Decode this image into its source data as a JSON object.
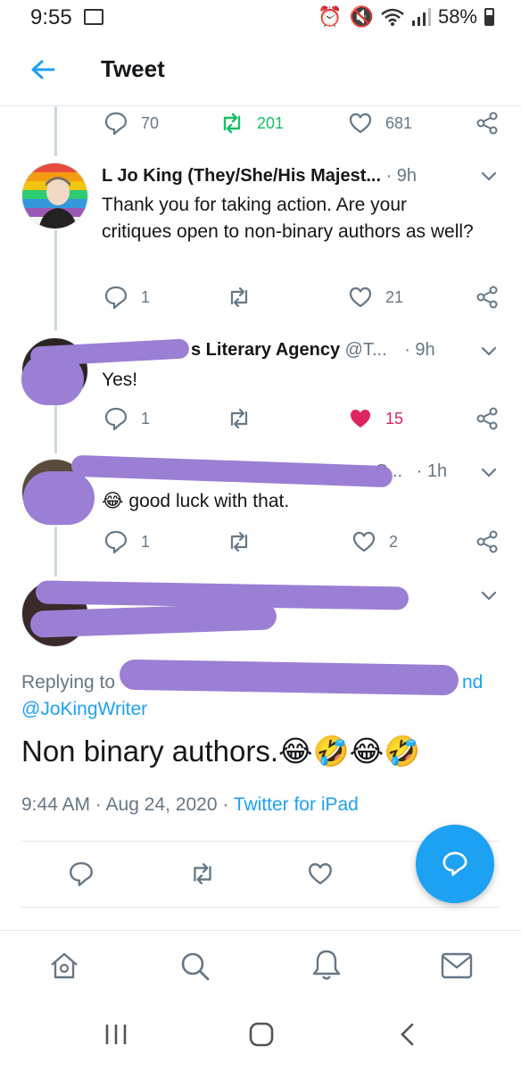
{
  "status_bar": {
    "time": "9:55",
    "battery": "58%"
  },
  "header": {
    "title": "Tweet"
  },
  "top_actions": {
    "reply_count": "70",
    "retweet_count": "201",
    "like_count": "681"
  },
  "replies": [
    {
      "name": "L Jo King (They/She/His Majest...",
      "time": "· 9h",
      "text": "Thank you for taking action. Are your critiques open to non-binary authors as well?",
      "reply_count": "1",
      "like_count": "21"
    },
    {
      "name": "s Literary Agency",
      "handle": "@T...",
      "time": "· 9h",
      "text": "Yes!",
      "reply_count": "1",
      "like_count": "15",
      "liked": true
    },
    {
      "name_fragment": "C...",
      "time": "· 1h",
      "emoji": "😂",
      "text": "good luck with that.",
      "reply_count": "1",
      "like_count": "2"
    }
  ],
  "main_tweet": {
    "replying_prefix": "Replying to",
    "replying_fragment": "nd",
    "replying_handle": "@JoKingWriter",
    "text": "Non binary authors.",
    "emojis": "😂🤣😂🤣",
    "timestamp": "9:44 AM · Aug 24, 2020 ·",
    "source": "Twitter for iPad"
  },
  "colors": {
    "accent": "#1da1f2",
    "retweet_active": "#17bf63",
    "like_active": "#e0245e",
    "muted": "#657786",
    "redaction": "#9b7fd4"
  },
  "icons": [
    "back-arrow-icon",
    "reply-icon",
    "retweet-icon",
    "like-icon",
    "share-icon",
    "chevron-down-icon",
    "compose-reply-icon",
    "home-icon",
    "search-icon",
    "notifications-icon",
    "messages-icon"
  ]
}
